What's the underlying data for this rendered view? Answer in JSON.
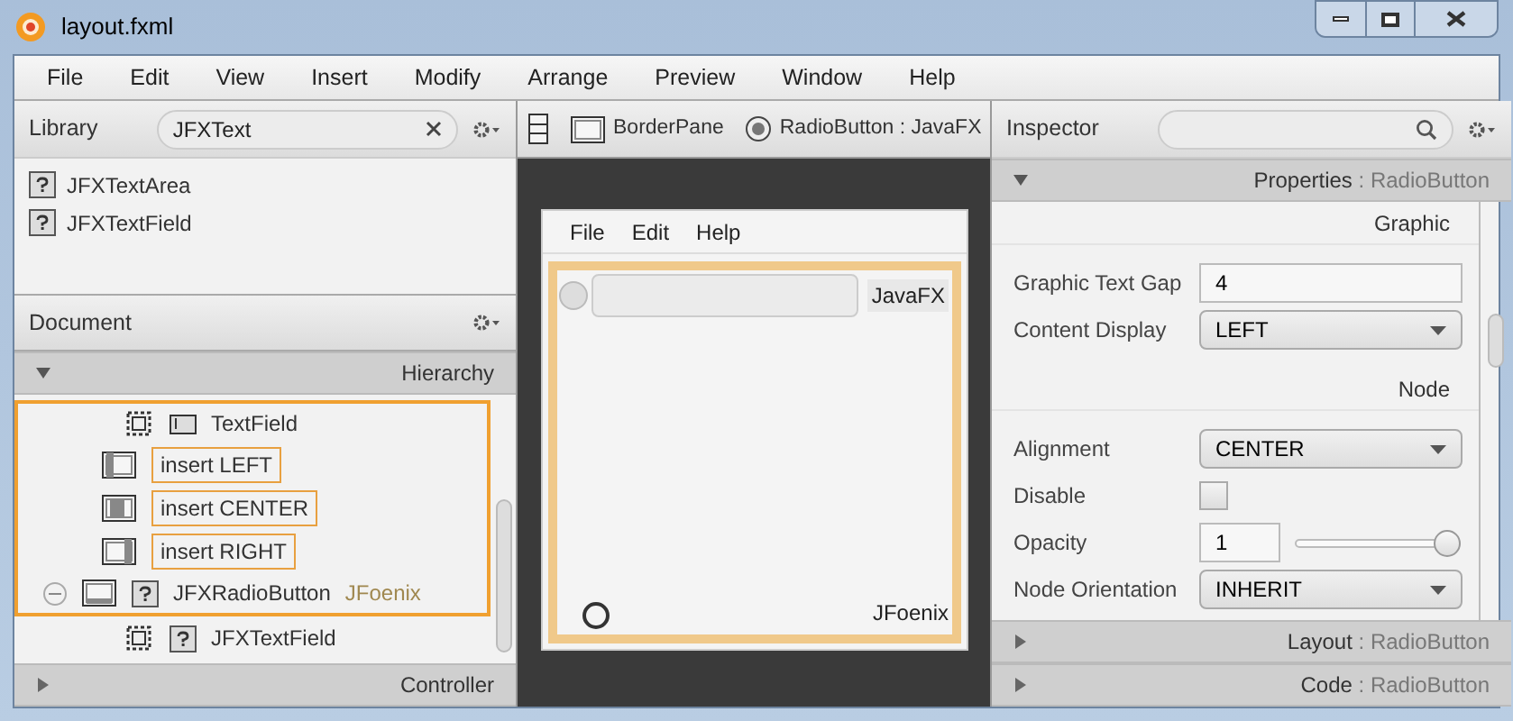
{
  "window": {
    "title": "layout.fxml"
  },
  "menu": [
    "File",
    "Edit",
    "View",
    "Insert",
    "Modify",
    "Arrange",
    "Preview",
    "Window",
    "Help"
  ],
  "library": {
    "title": "Library",
    "search": "JFXText",
    "items": [
      "JFXTextArea",
      "JFXTextField"
    ]
  },
  "document": {
    "title": "Document",
    "hierarchy": {
      "title": "Hierarchy",
      "expanded": true
    },
    "rows": [
      {
        "kind": "textfield",
        "label": "TextField",
        "selected": true
      },
      {
        "kind": "insert-left",
        "label": "insert LEFT",
        "selected": true
      },
      {
        "kind": "insert-center",
        "label": "insert CENTER",
        "selected": true
      },
      {
        "kind": "insert-right",
        "label": "insert RIGHT",
        "selected": true
      },
      {
        "kind": "custom",
        "label": "JFXRadioButton",
        "library": "JFoenix",
        "selected": true,
        "expanded": true,
        "children": [
          {
            "kind": "custom-leaf",
            "label": "JFXTextField",
            "selected": false
          }
        ]
      }
    ],
    "controller": {
      "title": "Controller",
      "expanded": false
    }
  },
  "breadcrumb": [
    {
      "kind": "vbox"
    },
    {
      "kind": "borderpane",
      "label": "BorderPane"
    },
    {
      "kind": "radio",
      "label": "RadioButton : JavaFX"
    }
  ],
  "preview": {
    "menu": [
      "File",
      "Edit",
      "Help"
    ],
    "top_radio": {
      "selected": false
    },
    "top_label": "JavaFX",
    "bottom_radio": {
      "selected": false
    },
    "bottom_label": "JFoenix"
  },
  "inspector": {
    "title": "Inspector",
    "properties": {
      "title": "Properties",
      "subject": ": RadioButton",
      "expanded": true
    },
    "sections": [
      {
        "title": "Graphic",
        "rows": [
          {
            "kind": "text",
            "label": "Graphic Text Gap",
            "value": "4"
          },
          {
            "kind": "select",
            "label": "Content Display",
            "value": "LEFT"
          }
        ]
      },
      {
        "title": "Node",
        "rows": [
          {
            "kind": "select",
            "label": "Alignment",
            "value": "CENTER"
          },
          {
            "kind": "checkbox",
            "label": "Disable",
            "checked": false
          },
          {
            "kind": "slider",
            "label": "Opacity",
            "value": "1",
            "level": 1
          },
          {
            "kind": "select",
            "label": "Node Orientation",
            "value": "INHERIT"
          }
        ]
      }
    ],
    "layout": {
      "title": "Layout",
      "subject": ": RadioButton",
      "expanded": false
    },
    "code": {
      "title": "Code",
      "subject": ": RadioButton",
      "expanded": false
    }
  }
}
